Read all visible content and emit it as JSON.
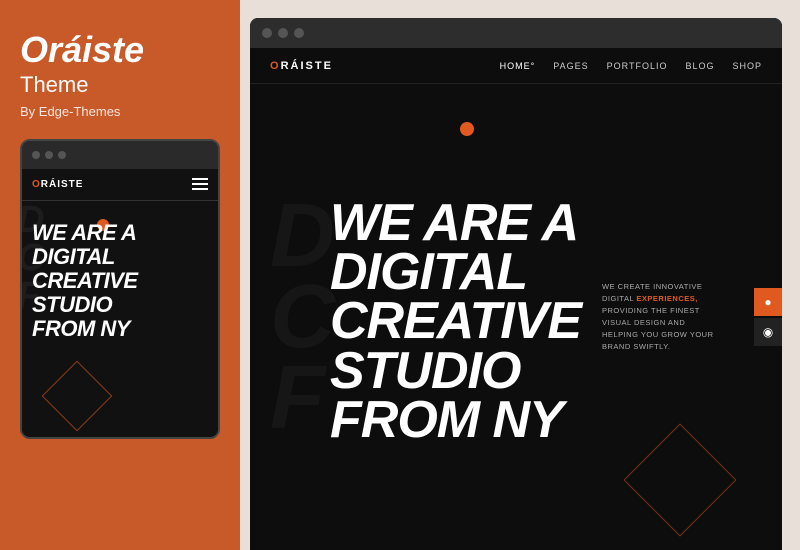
{
  "leftPanel": {
    "title": "Oráiste",
    "subtitle": "Theme",
    "author": "By Edge-Themes"
  },
  "mobileBrowser": {
    "dots": [
      "dot1",
      "dot2",
      "dot3"
    ],
    "logo": "ORÁISTE",
    "logoAccent": "O",
    "heroLines": [
      "WE ARE A",
      "DIGITAL",
      "CREATIVE",
      "STUDIO",
      "FROM NY"
    ]
  },
  "desktopBrowser": {
    "dots": [
      "dot1",
      "dot2",
      "dot3"
    ],
    "logo": "ORÁISTE",
    "logoAccent": "O",
    "navLinks": [
      "HOME°",
      "PAGES",
      "PORTFOLIO",
      "BLOG",
      "SHOP"
    ],
    "heroLines": [
      "WE ARE A",
      "DIGITAL",
      "CREATIVE",
      "STUDIO",
      "FROM NY"
    ],
    "sideText": "WE CREATE INNOVATIVE DIGITAL EXPERIENCES, PROVIDING THE FINEST VISUAL DESIGN AND HELPING YOU GROW YOUR BRAND SWIFTLY.",
    "sideTextAccent": "EXPERIENCES,"
  },
  "colors": {
    "accent": "#e05a20",
    "background": "#c85a2a",
    "dark": "#0d0d0d",
    "white": "#ffffff"
  }
}
